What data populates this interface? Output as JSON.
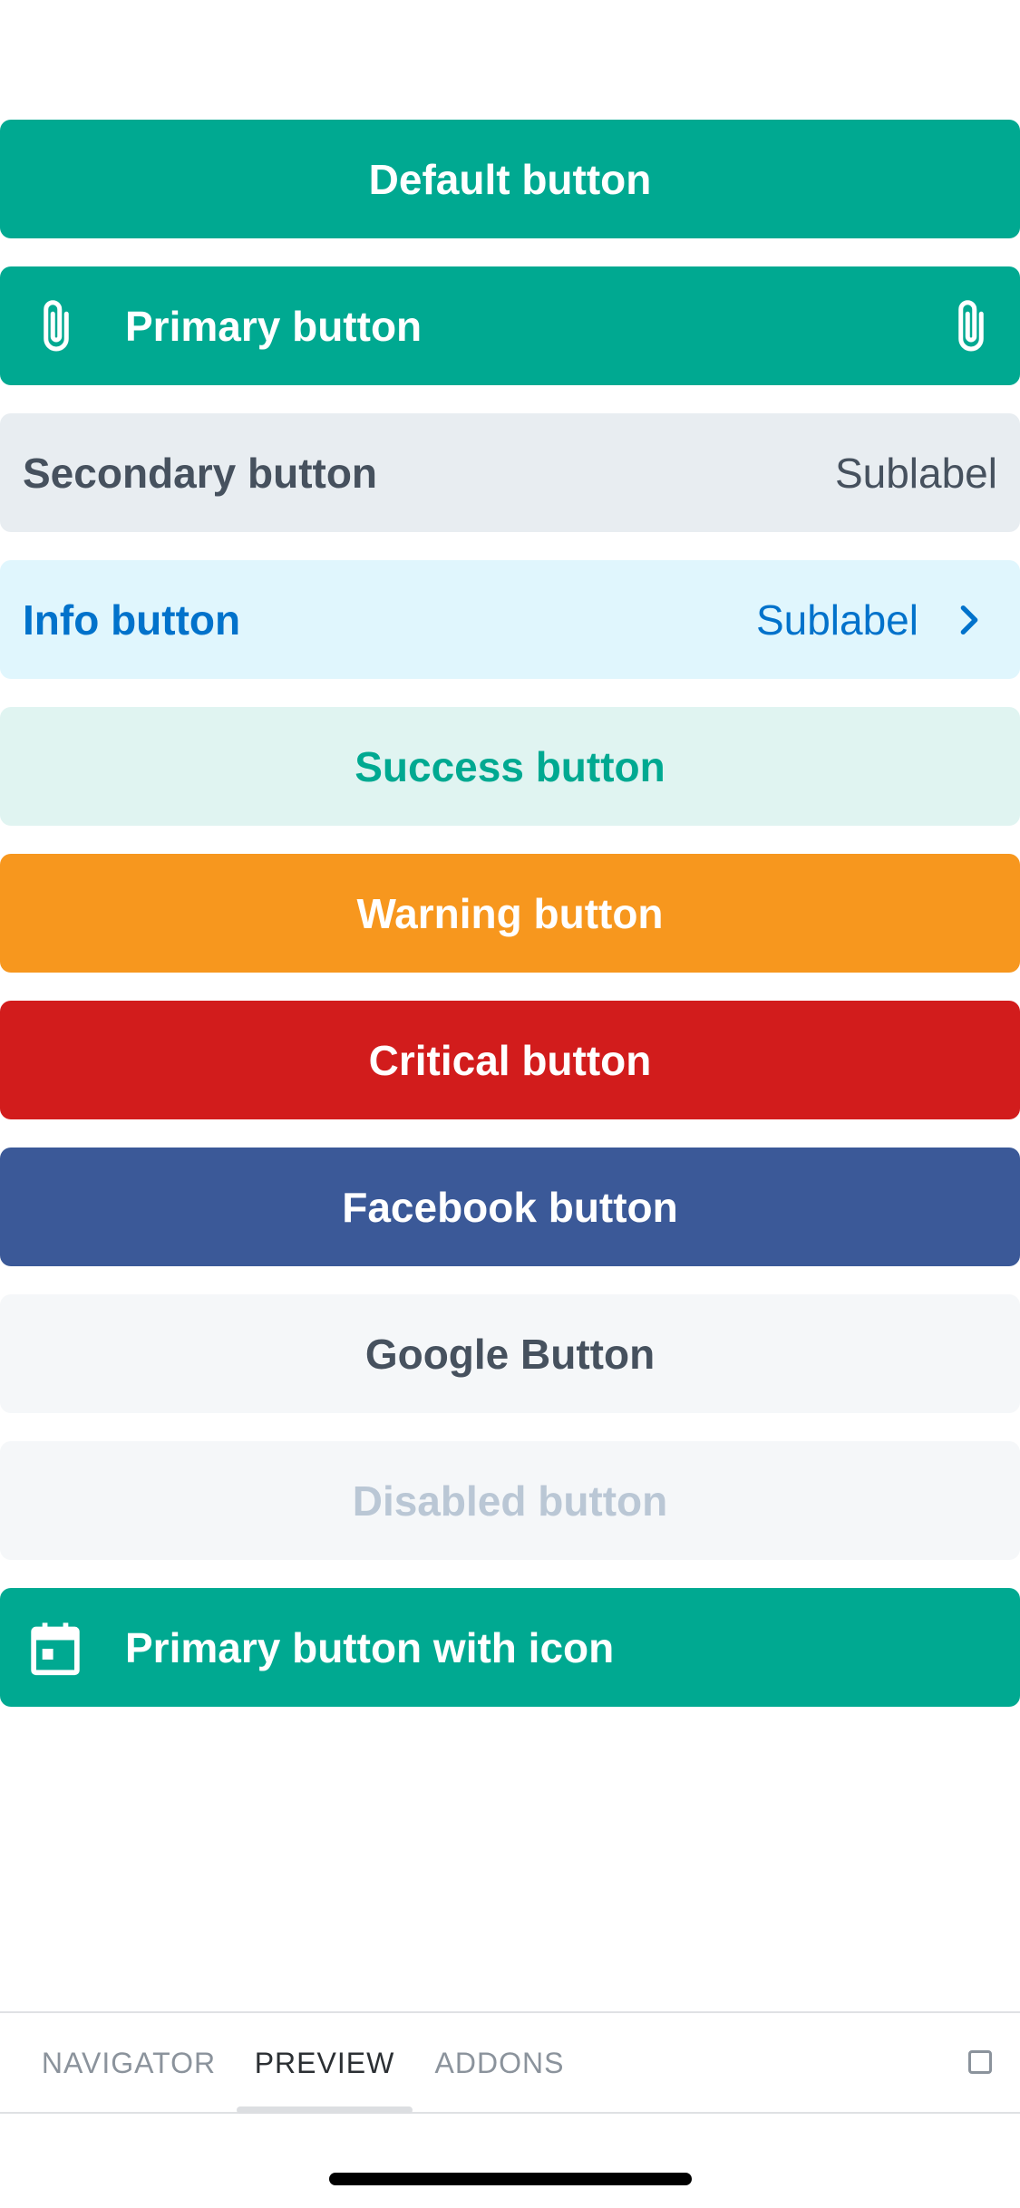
{
  "buttons": {
    "default": {
      "label": "Default button"
    },
    "primary": {
      "label": "Primary button",
      "icon_left": "paperclip-icon",
      "icon_right": "paperclip-icon"
    },
    "secondary": {
      "label": "Secondary button",
      "sublabel": "Sublabel"
    },
    "info": {
      "label": "Info button",
      "sublabel": "Sublabel",
      "icon_right": "chevron-right-icon"
    },
    "success": {
      "label": "Success button"
    },
    "warning": {
      "label": "Warning button"
    },
    "critical": {
      "label": "Critical button"
    },
    "facebook": {
      "label": "Facebook button"
    },
    "google": {
      "label": "Google Button"
    },
    "disabled": {
      "label": "Disabled button"
    },
    "primary_with_icon": {
      "label": "Primary button with icon",
      "icon_left": "calendar-icon"
    }
  },
  "tabs": [
    {
      "label": "NAVIGATOR",
      "active": false
    },
    {
      "label": "PREVIEW",
      "active": true
    },
    {
      "label": "ADDONS",
      "active": false
    }
  ],
  "colors": {
    "primary": "#00a991",
    "secondary_bg": "#e8edf1",
    "info_bg": "#e0f6fd",
    "info_text": "#0172cb",
    "success_bg": "#e0f4f1",
    "warning": "#f7971e",
    "critical": "#d21c1c",
    "facebook": "#3b5998",
    "google_bg": "#f5f7f9",
    "disabled_text": "#bac7d5"
  }
}
